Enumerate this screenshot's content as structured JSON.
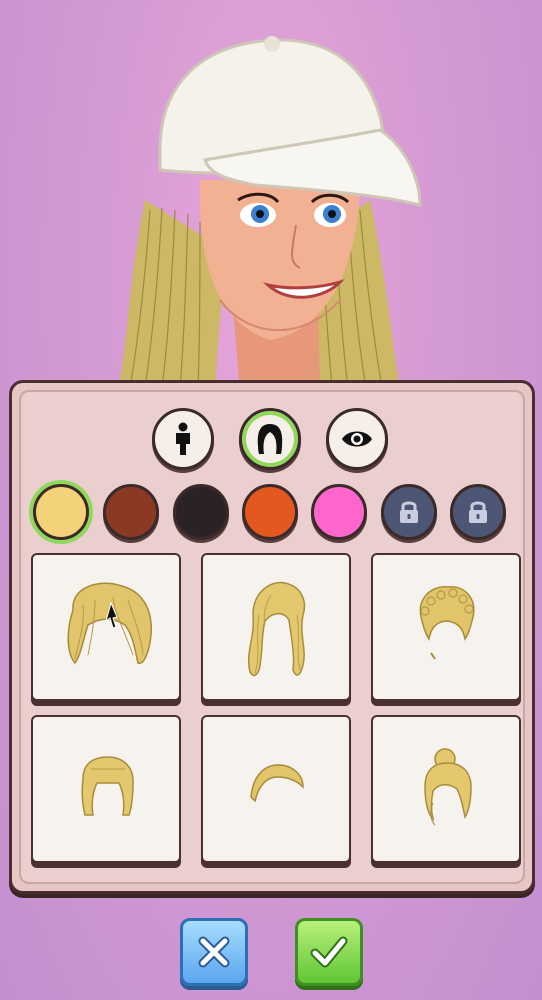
{
  "palette": {
    "background": "#d49ad3",
    "accent_active": "#8fd95a",
    "panel": "#e6c7c6"
  },
  "categories": [
    {
      "name": "body",
      "icon": "person-icon"
    },
    {
      "name": "hair",
      "icon": "hair-icon",
      "active": true
    },
    {
      "name": "eyes",
      "icon": "eye-icon"
    }
  ],
  "hair_colors": [
    {
      "color": "#f4d27a",
      "active": true
    },
    {
      "color": "#8a3a22"
    },
    {
      "color": "#2a2224"
    },
    {
      "color": "#e2581e"
    },
    {
      "color": "#ff66cc"
    },
    {
      "color": "#4e5675",
      "locked": true,
      "icon": "lock-icon"
    },
    {
      "color": "#4e5675",
      "locked": true,
      "icon": "lock-icon"
    }
  ],
  "hairstyles": [
    {
      "style": "braided-bob",
      "selected": true
    },
    {
      "style": "long-wavy"
    },
    {
      "style": "curly-updo"
    },
    {
      "style": "bob-with-bangs"
    },
    {
      "style": "short-cap"
    },
    {
      "style": "messy-bun"
    }
  ],
  "actions": {
    "cancel_icon": "x-icon",
    "confirm_icon": "checkmark-icon"
  }
}
